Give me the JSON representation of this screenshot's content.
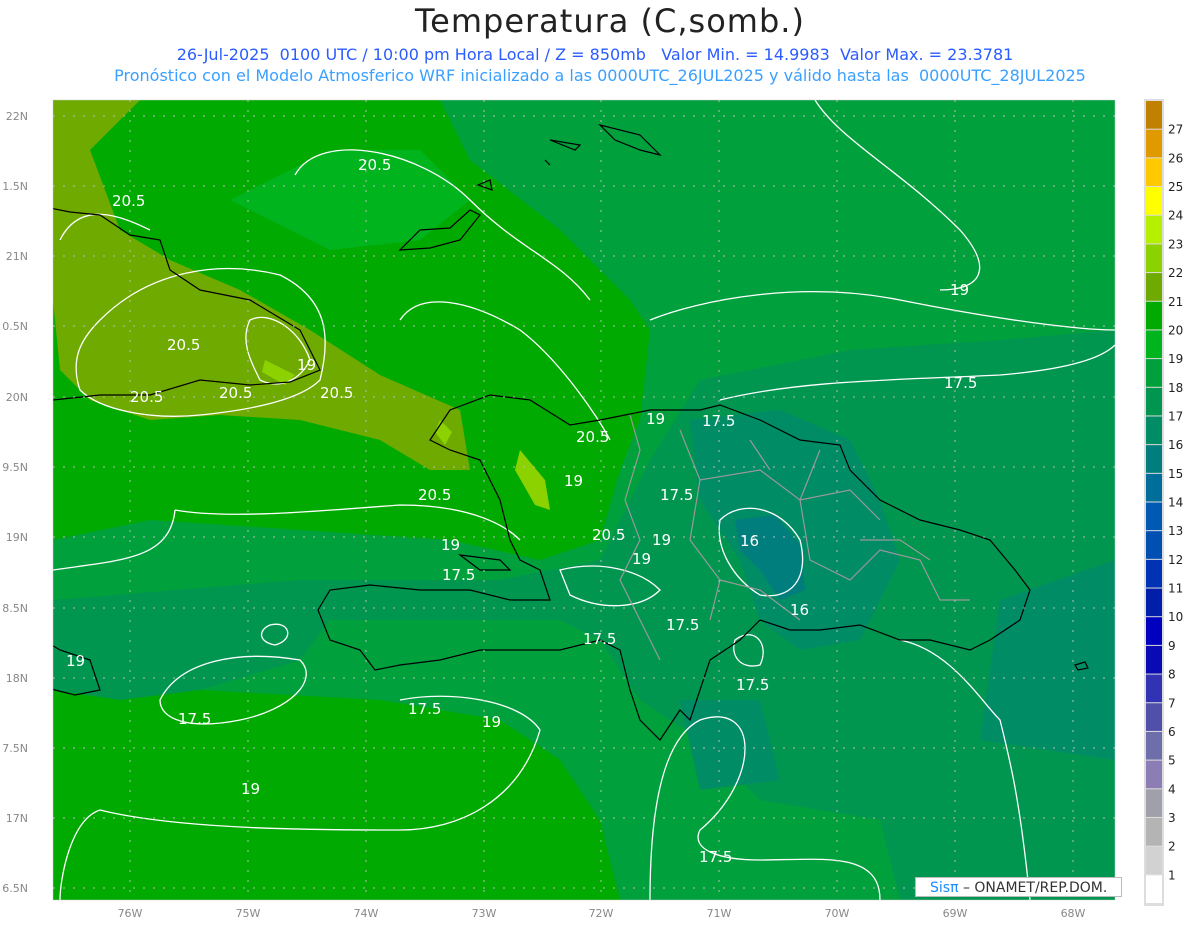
{
  "title": "Temperatura (C,somb.)",
  "subtitle_line1": "26-Jul-2025  0100 UTC / 10:00 pm Hora Local / Z = 850mb   Valor Min. = 14.9983  Valor Max. = 23.3781",
  "subtitle_line2": "Pronóstico con el Modelo Atmosferico WRF inicializado a las 0000UTC_26JUL2025 y válido hasta las  0000UTC_28JUL2025",
  "lat_labels": [
    "22N",
    "1.5N",
    "21N",
    "0.5N",
    "20N",
    "9.5N",
    "19N",
    "8.5N",
    "18N",
    "7.5N",
    "17N",
    "6.5N"
  ],
  "lon_labels": [
    "76W",
    "75W",
    "74W",
    "73W",
    "72W",
    "71W",
    "70W",
    "69W",
    "68W"
  ],
  "contour_labels": [
    "20.5",
    "20.5",
    "20.5",
    "19",
    "20.5",
    "20.5",
    "20.5",
    "20.5",
    "20.5",
    "19",
    "19",
    "17.5",
    "17.5",
    "19",
    "20.5",
    "19",
    "19",
    "17.5",
    "17.5",
    "17.5",
    "16",
    "16",
    "17.5",
    "19",
    "17.5",
    "17.5",
    "19",
    "17.5",
    "19",
    "17.5",
    "19"
  ],
  "colorbar": {
    "labels": [
      "27",
      "26",
      "25",
      "24",
      "23",
      "22",
      "21",
      "20",
      "19",
      "18",
      "17",
      "16",
      "15",
      "14",
      "13",
      "12",
      "11",
      "10",
      "9",
      "8",
      "7",
      "6",
      "5",
      "4",
      "3",
      "2",
      "1"
    ],
    "colors": [
      "#c08000",
      "#e09a00",
      "#ffc800",
      "#ffff00",
      "#b4f000",
      "#8cd200",
      "#6eaa00",
      "#00aa00",
      "#00b41e",
      "#00a03c",
      "#009650",
      "#008c64",
      "#007d7d",
      "#006e9b",
      "#005ab4",
      "#0050b4",
      "#0032b4",
      "#001eaa",
      "#0000be",
      "#0a0ab4",
      "#3232b4",
      "#5050aa",
      "#6e6eaa",
      "#8c7db4",
      "#a0a0aa",
      "#b4b4b4",
      "#d2d2d2",
      "#ffffff"
    ]
  },
  "credit": {
    "brand": "Sisπ",
    "text": " –  ONAMET/REP.DOM."
  }
}
